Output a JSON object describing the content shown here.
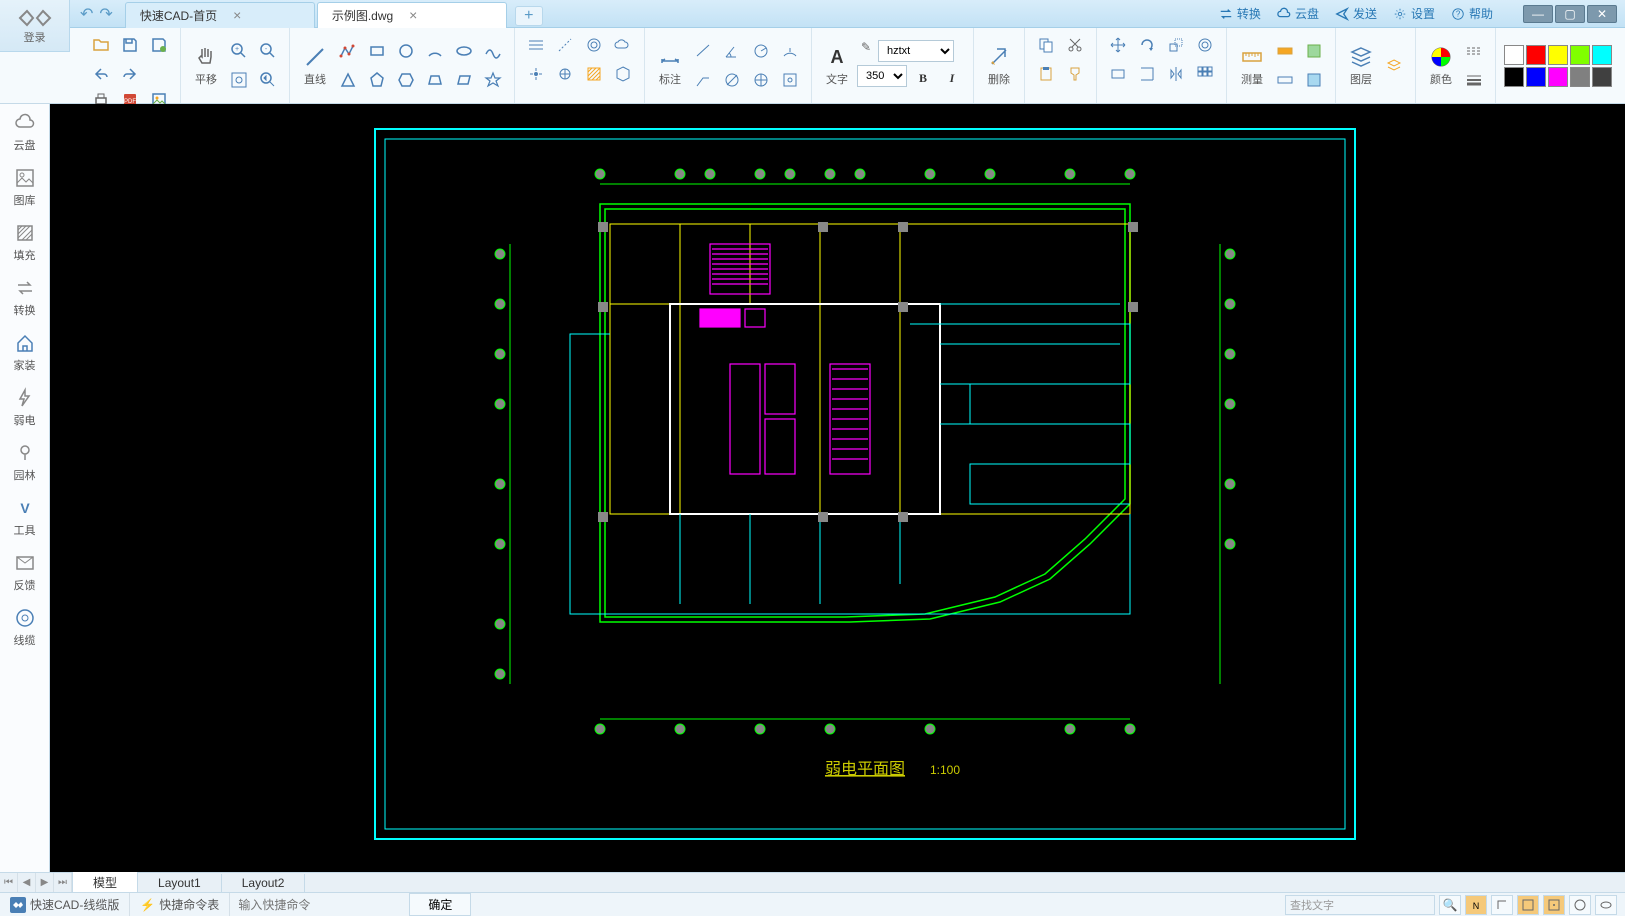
{
  "titlebar": {
    "login": "登录",
    "tabs": [
      {
        "label": "快速CAD-首页",
        "active": false
      },
      {
        "label": "示例图.dwg",
        "active": true
      }
    ],
    "right": {
      "convert": "转换",
      "cloud": "云盘",
      "send": "发送",
      "settings": "设置",
      "help": "帮助"
    }
  },
  "ribbon": {
    "pan_label": "平移",
    "line_label": "直线",
    "annotate_label": "标注",
    "text_label": "文字",
    "delete_label": "删除",
    "measure_label": "测量",
    "layer_label": "图层",
    "color_label": "颜色",
    "font_combo": "hztxt",
    "size_combo": "350",
    "bold": "B",
    "italic": "I",
    "colors": [
      "#ffffff",
      "#ff0000",
      "#ffff00",
      "#80ff00",
      "#00ffff",
      "#0000ff",
      "#000000",
      "#ff00ff",
      "#808080",
      "#404040"
    ]
  },
  "sidebar": [
    {
      "id": "cloud",
      "label": "云盘"
    },
    {
      "id": "gallery",
      "label": "图库"
    },
    {
      "id": "fill",
      "label": "填充"
    },
    {
      "id": "convert",
      "label": "转换"
    },
    {
      "id": "home",
      "label": "家装"
    },
    {
      "id": "elec",
      "label": "弱电"
    },
    {
      "id": "garden",
      "label": "园林"
    },
    {
      "id": "tools",
      "label": "工具"
    },
    {
      "id": "feedback",
      "label": "反馈"
    },
    {
      "id": "cable",
      "label": "线缆"
    }
  ],
  "drawing": {
    "title": "弱电平面图",
    "scale": "1:100"
  },
  "bottom_tabs": {
    "model": "模型",
    "layout1": "Layout1",
    "layout2": "Layout2"
  },
  "statusbar": {
    "app_name": "快速CAD-线缆版",
    "quick_cmd": "快捷命令表",
    "cmd_placeholder": "输入快捷命令",
    "confirm": "确定",
    "search_placeholder": "查找文字"
  }
}
